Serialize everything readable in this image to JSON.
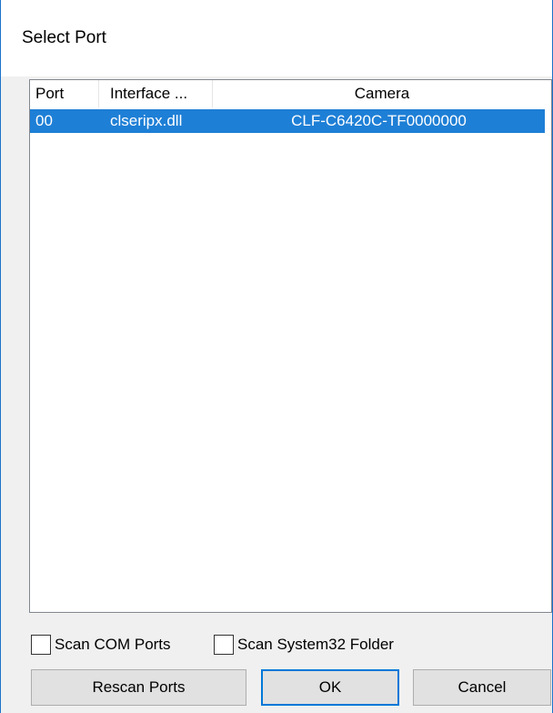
{
  "window": {
    "title": "Select Port"
  },
  "port_list": {
    "columns": [
      "Port",
      "Interface ...",
      "Camera"
    ],
    "rows": [
      {
        "port": "00",
        "interface": "clseripx.dll",
        "camera": "CLF-C6420C-TF0000000",
        "selected": true
      }
    ]
  },
  "options": {
    "scan_com_label": "Scan COM Ports",
    "scan_com_checked": false,
    "scan_system32_label": "Scan System32 Folder",
    "scan_system32_checked": false
  },
  "buttons": {
    "rescan_label": "Rescan Ports",
    "ok_label": "OK",
    "cancel_label": "Cancel"
  },
  "colors": {
    "selection": "#1e7fd6",
    "window_border": "#1a73c9",
    "default_button_border": "#0078d7"
  }
}
